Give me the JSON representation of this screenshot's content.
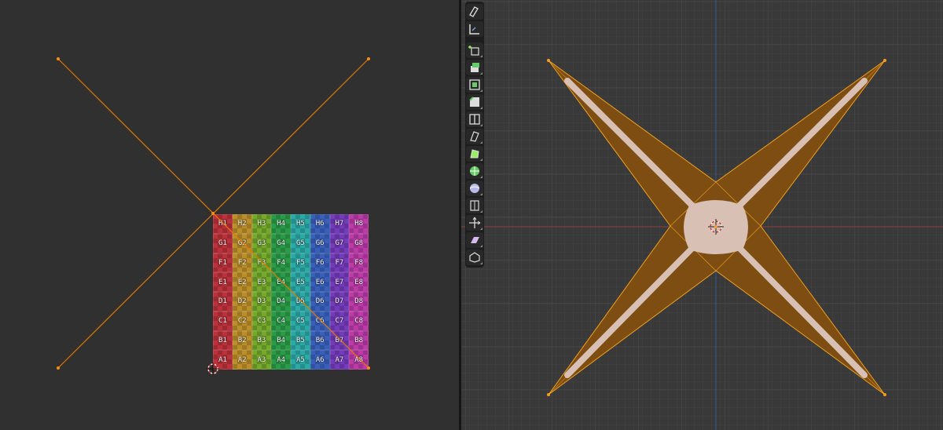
{
  "uv_editor": {
    "texture_rows": [
      [
        "H1",
        "H2",
        "H3",
        "H4",
        "H5",
        "H6",
        "H7",
        "H8"
      ],
      [
        "G1",
        "G2",
        "G3",
        "G4",
        "G5",
        "G6",
        "G7",
        "G8"
      ],
      [
        "F1",
        "F2",
        "F3",
        "F4",
        "F5",
        "F6",
        "F7",
        "F8"
      ],
      [
        "E1",
        "E2",
        "E3",
        "E4",
        "E5",
        "E6",
        "E7",
        "E8"
      ],
      [
        "D1",
        "D2",
        "D3",
        "D4",
        "D5",
        "D6",
        "D7",
        "D8"
      ],
      [
        "C1",
        "C2",
        "C3",
        "C4",
        "C5",
        "C6",
        "C7",
        "C8"
      ],
      [
        "B1",
        "B2",
        "B3",
        "B4",
        "B5",
        "B6",
        "B7",
        "B8"
      ],
      [
        "A1",
        "A2",
        "A3",
        "A4",
        "A5",
        "A6",
        "A7",
        "A8"
      ]
    ],
    "column_colors": [
      "#c8323c",
      "#c89628",
      "#7ab42a",
      "#2aa64a",
      "#2ab4b0",
      "#3a64c8",
      "#7a3cc8",
      "#c83cb4"
    ],
    "uv_edge_color": "#e07800"
  },
  "viewport_3d": {
    "mesh_fill_color": "#7d4d12",
    "mesh_edge_color": "#f0a020",
    "core_color": "#d8c0b4",
    "x_axis_color": "#8a3a3a",
    "y_axis_color": "#2f5c8e"
  },
  "toolbar": {
    "tools": [
      {
        "name": "annotate-tool",
        "icon": "annotate-icon"
      },
      {
        "name": "measure-tool",
        "icon": "measure-icon"
      },
      {
        "name": "add-cube-tool",
        "icon": "add-cube-icon"
      },
      {
        "name": "extrude-region-tool",
        "icon": "extrude-icon"
      },
      {
        "name": "inset-faces-tool",
        "icon": "inset-icon"
      },
      {
        "name": "bevel-tool",
        "icon": "bevel-icon"
      },
      {
        "name": "loop-cut-tool",
        "icon": "loop-cut-icon"
      },
      {
        "name": "knife-tool",
        "icon": "knife-icon"
      },
      {
        "name": "poly-build-tool",
        "icon": "poly-build-icon"
      },
      {
        "name": "spin-tool",
        "icon": "spin-icon"
      },
      {
        "name": "smooth-tool",
        "icon": "smooth-icon"
      },
      {
        "name": "edge-slide-tool",
        "icon": "edge-slide-icon"
      },
      {
        "name": "shrink-fatten-tool",
        "icon": "shrink-fatten-icon"
      },
      {
        "name": "shear-tool",
        "icon": "shear-icon"
      },
      {
        "name": "rip-region-tool",
        "icon": "rip-icon"
      }
    ]
  }
}
